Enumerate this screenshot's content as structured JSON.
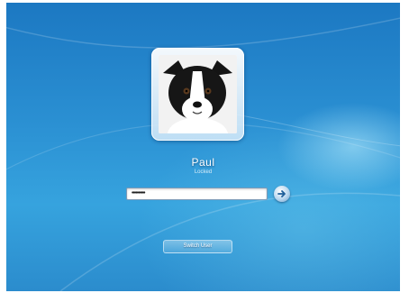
{
  "logon": {
    "username": "Paul",
    "sub_label": "Locked",
    "password_masked": "••••••••••",
    "switch_user_label": "Switch User"
  },
  "icons": {
    "avatar": "border-collie-dog-photo",
    "submit": "arrow-right-icon"
  },
  "colors": {
    "background_top": "#1c78c2",
    "background_bottom": "#36a3de",
    "field_background": "#ffffff"
  }
}
